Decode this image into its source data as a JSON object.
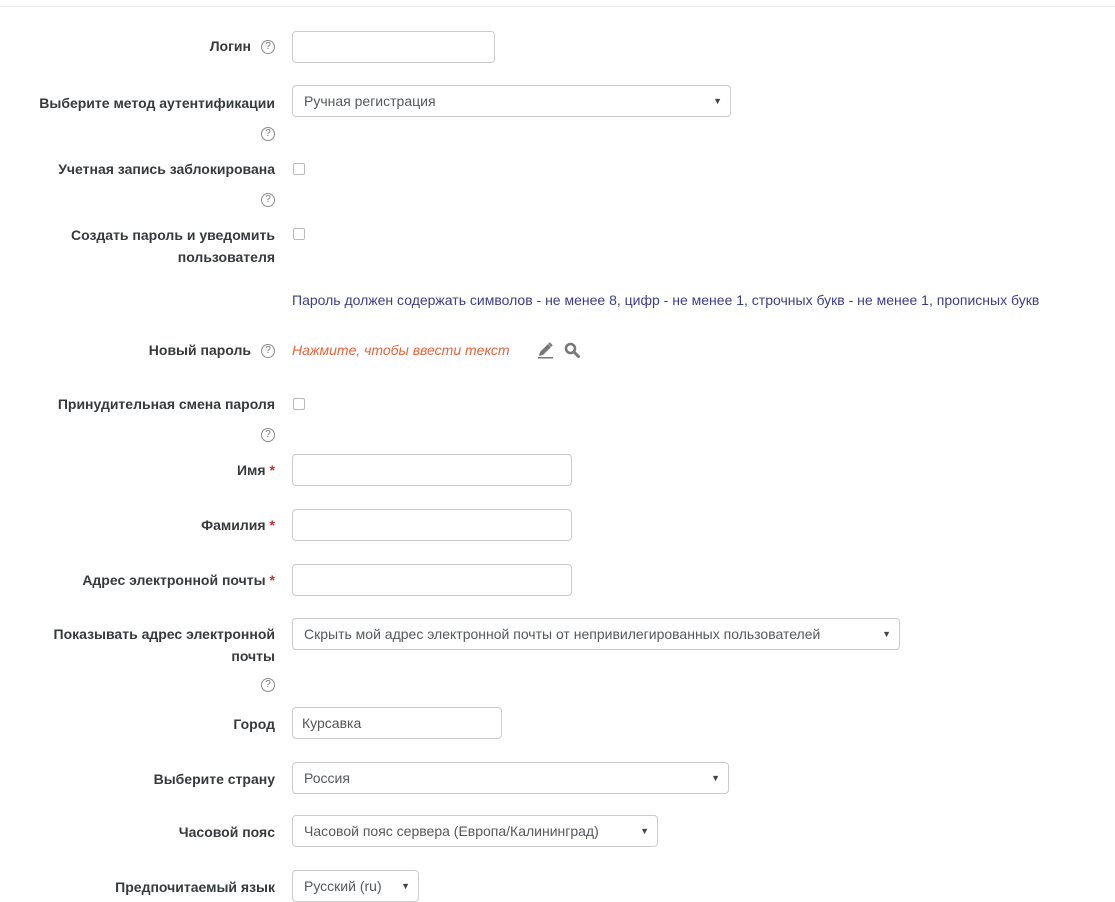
{
  "form": {
    "login": {
      "label": "Логин",
      "value": ""
    },
    "auth": {
      "label": "Выберите метод аутентификации",
      "selected": "Ручная регистрация"
    },
    "suspended": {
      "label": "Учетная запись заблокирована"
    },
    "create_password": {
      "label_line1": "Создать пароль и уведомить",
      "label_line2": "пользователя"
    },
    "password_policy": "Пароль должен содержать символов - не менее 8, цифр - не менее 1, строчных букв - не менее 1, прописных букв",
    "new_password": {
      "label": "Новый пароль",
      "link_text": "Нажмите, чтобы ввести текст"
    },
    "force_change": {
      "label": "Принудительная смена пароля"
    },
    "firstname": {
      "label": "Имя",
      "value": ""
    },
    "lastname": {
      "label": "Фамилия",
      "value": ""
    },
    "email": {
      "label": "Адрес электронной почты",
      "value": ""
    },
    "maildisplay": {
      "label_line1": "Показывать адрес электронной",
      "label_line2": "почты",
      "selected": "Скрыть мой адрес электронной почты от непривилегированных пользователей"
    },
    "city": {
      "label": "Город",
      "value": "Курсавка"
    },
    "country": {
      "label": "Выберите страну",
      "selected": "Россия"
    },
    "timezone": {
      "label": "Часовой пояс",
      "selected": "Часовой пояс сервера (Европа/Калининград)"
    },
    "language": {
      "label": "Предпочитаемый язык",
      "selected": "Русский (ru)"
    }
  },
  "symbols": {
    "help": "?",
    "required": "*",
    "dropdown_arrow": "▼"
  },
  "colors": {
    "label_text": "#373a3c",
    "required_marker": "#c9302c",
    "policy_text": "#3c3c8c",
    "password_link": "#e8623a",
    "icon_gray": "#777777"
  }
}
